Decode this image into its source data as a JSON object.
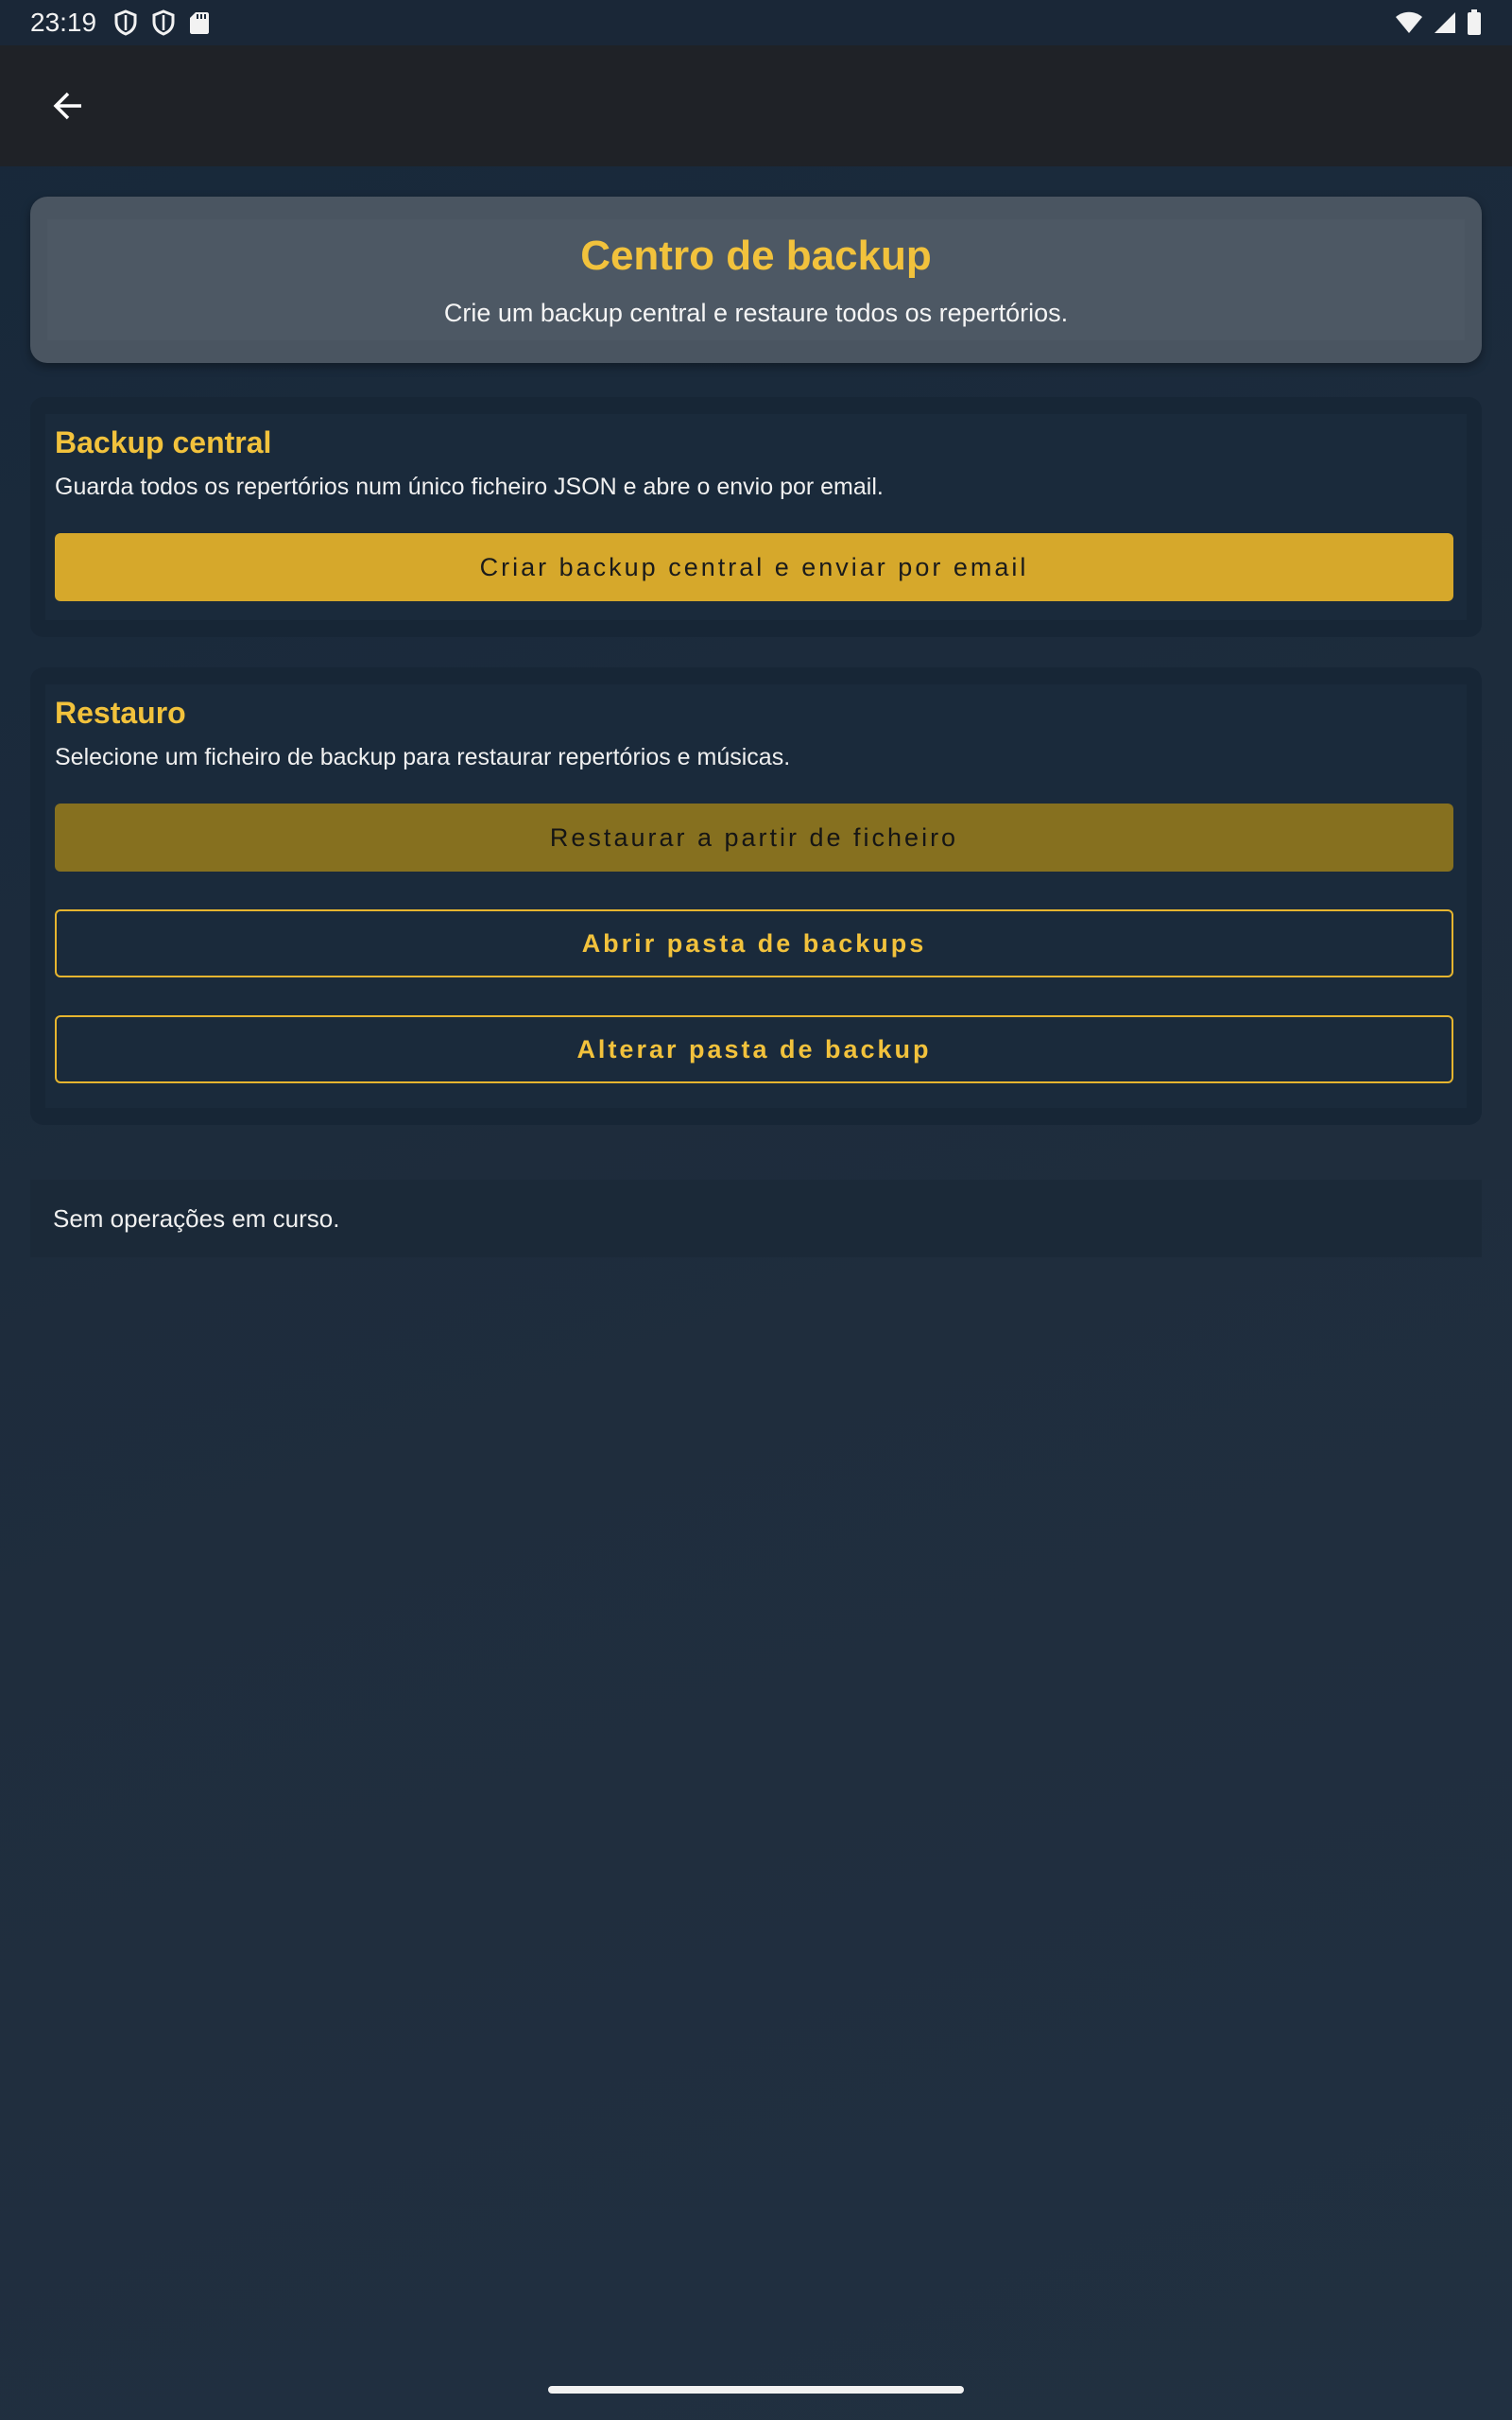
{
  "status_bar": {
    "time": "23:19",
    "left_icons": [
      "shield-icon",
      "shield-icon",
      "sd-card-icon"
    ],
    "right_icons": [
      "wifi-icon",
      "signal-icon",
      "battery-icon"
    ]
  },
  "toolbar": {
    "back_icon": "arrow-left-icon"
  },
  "header": {
    "title": "Centro de backup",
    "subtitle": "Crie um backup central e restaure todos os repertórios."
  },
  "backup_section": {
    "title": "Backup central",
    "description": "Guarda todos os repertórios num único ficheiro JSON e abre o envio por email.",
    "button_label": "Criar backup central e enviar por email"
  },
  "restore_section": {
    "title": "Restauro",
    "description": "Selecione um ficheiro de backup para restaurar repertórios e músicas.",
    "restore_button_label": "Restaurar a partir de ficheiro",
    "open_folder_label": "Abrir pasta de backups",
    "change_folder_label": "Alterar pasta de backup"
  },
  "status": {
    "message": "Sem operações em curso."
  },
  "colors": {
    "accent": "#f2c23c",
    "button_fill": "#d6a82b",
    "button_dim": "#86701f",
    "background": "#1c2a3a"
  }
}
